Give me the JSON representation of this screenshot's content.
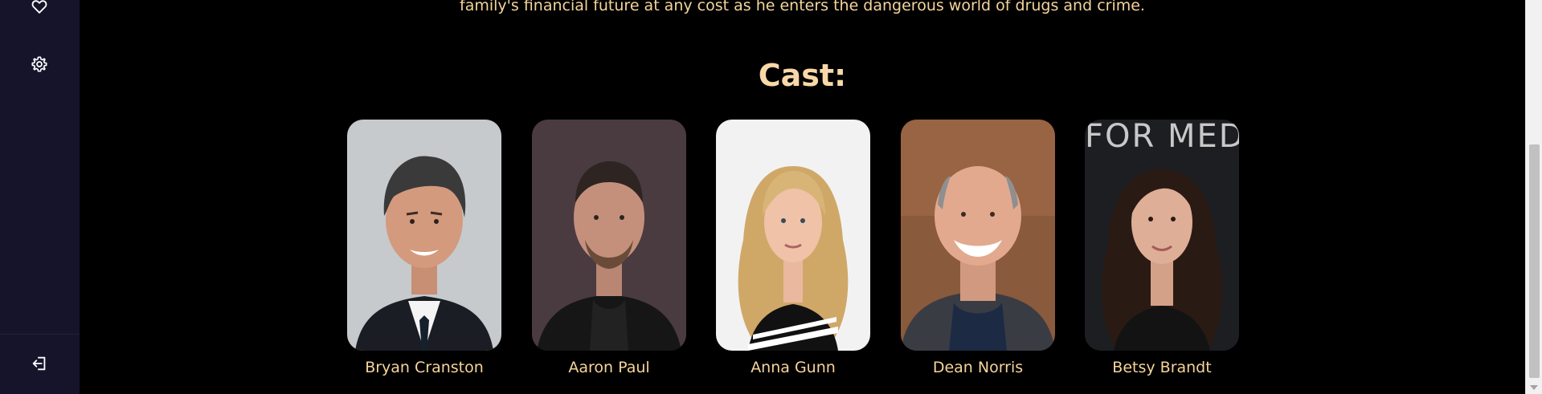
{
  "sidebar": {
    "icons": [
      "heart-icon",
      "gear-icon",
      "logout-icon"
    ]
  },
  "show": {
    "synopsis_tail": "family's financial future at any cost as he enters the dangerous world of drugs and crime."
  },
  "cast": {
    "title": "Cast:",
    "members": [
      {
        "name": "Bryan Cranston"
      },
      {
        "name": "Aaron Paul"
      },
      {
        "name": "Anna Gunn"
      },
      {
        "name": "Dean Norris"
      },
      {
        "name": "Betsy Brandt",
        "photo_text": "FOR MEDI"
      }
    ]
  },
  "colors": {
    "accent": "#f5d49a",
    "sidebar_bg": "#16142a",
    "page_bg": "#000000"
  }
}
